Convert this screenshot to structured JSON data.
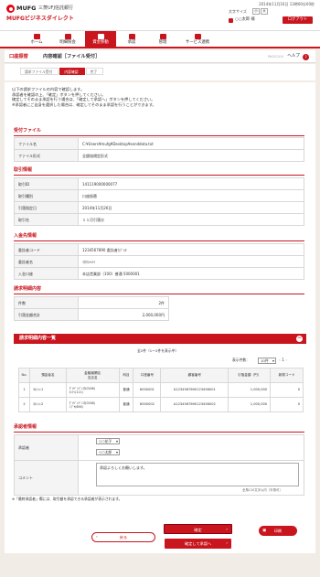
{
  "header": {
    "logo": "MUFG",
    "bank": "三菱UFJ信託銀行",
    "sub": "MUFGビジネスダイレクト",
    "datetime": "2014年11月16日 13時00分00秒",
    "fontsize_label": "文字サイズ",
    "font_small": "小",
    "font_large": "大",
    "user": "○○太郎 様",
    "logout": "ログアウト"
  },
  "nav": [
    {
      "label": "ホーム"
    },
    {
      "label": "明細照会"
    },
    {
      "label": "資金移動"
    },
    {
      "label": "承認"
    },
    {
      "label": "管理"
    },
    {
      "label": "サービス連携"
    }
  ],
  "title": {
    "category": "口座振替",
    "page": "内容確認［ファイル受付］",
    "code": "PAGE100",
    "help": "ヘルプ",
    "help_icon": "?"
  },
  "steps": [
    "請求ファイル受付",
    "内容確認",
    "完了"
  ],
  "intro": [
    "以下の請求ファイルの内容で確認します。",
    "承認者を確認の上、「確定」ボタンを押してください。",
    "確定してそのまま承認を行う場合は、「確定して承認へ」ボタンを押してください。",
    "※承認者にご自身を選択した場合は、確定してそのまま承認を行うことができます。"
  ],
  "receipt": {
    "title": "受付ファイル",
    "rows": [
      {
        "label": "ファイル名",
        "value": "C:¥Users¥mufg¥Desktop¥senddata.txt"
      },
      {
        "label": "ファイル形式",
        "value": "全銀協規定形式"
      }
    ]
  },
  "trade": {
    "title": "取引情報",
    "rows": [
      {
        "label": "取引ID",
        "value": "141119000000077"
      },
      {
        "label": "取引種別",
        "value": "口座振替"
      },
      {
        "label": "引落指定日",
        "value": "2014年11月26日"
      },
      {
        "label": "取引名",
        "value": "１１月引落分"
      }
    ]
  },
  "payee": {
    "title": "入金先情報",
    "rows": [
      {
        "label": "委託者コード",
        "value": "1234567890 委託者ｶﾌﾞｼｷ"
      },
      {
        "label": "委託者名",
        "value": "ｲﾀｸｼｬﾒｲ"
      },
      {
        "label": "入金口座",
        "value": "本店営業部（100）普通 5000001"
      }
    ]
  },
  "summary": {
    "title": "請求明細内容",
    "rows": [
      {
        "label": "件数",
        "value": "2件"
      },
      {
        "label": "引落金額合計",
        "value": "2,000,000円"
      }
    ]
  },
  "list": {
    "title": "請求明細内容一覧",
    "toggle": "−",
    "count": "全2件（1～2件を表示中）",
    "per_page_label": "表示件数：",
    "per_page": "10件",
    "page": "1",
    "prev": "‹",
    "next": "›",
    "headers": [
      "No.",
      "預金者名",
      "金融機関名\n支店名",
      "科目",
      "口座番号",
      "顧客番号",
      "引落金額（円）",
      "新規コード"
    ],
    "rows": [
      {
        "no": "1",
        "name": "ﾖｷﾝｼｬ1",
        "bank": "ｸﾞﾂﾍﾟﾝｷﾞﾝｺｳ(0208)\nﾎﾝﾃﾝ(111)",
        "type": "普通",
        "acct": "6000001",
        "cust": "A1234567890123456001",
        "amt": "1,000,000",
        "code": "0"
      },
      {
        "no": "2",
        "name": "ﾖｷﾝｼｬ2",
        "bank": "ｸﾞﾂﾍﾟﾝｷﾞﾝｺｳ(0208)\nｼﾌﾞﾔ(656)",
        "type": "普通",
        "acct": "6000002",
        "cust": "A1234567890123456002",
        "amt": "1,000,000",
        "code": "0"
      }
    ]
  },
  "approver": {
    "title": "承認者情報",
    "label": "承認者",
    "opt1": "○○花子",
    "opt2": "○○太郎",
    "comment_label": "コメント",
    "comment": "承認よろしくお願いします。",
    "limit": "全角120文字以内［半角可］"
  },
  "note": "※「最終承認者」欄には、取引額を承認できる承認者が表示されます。",
  "buttons": {
    "back": "戻る",
    "confirm": "確定",
    "confirm_approve": "確定して承認へ",
    "print": "印刷"
  }
}
